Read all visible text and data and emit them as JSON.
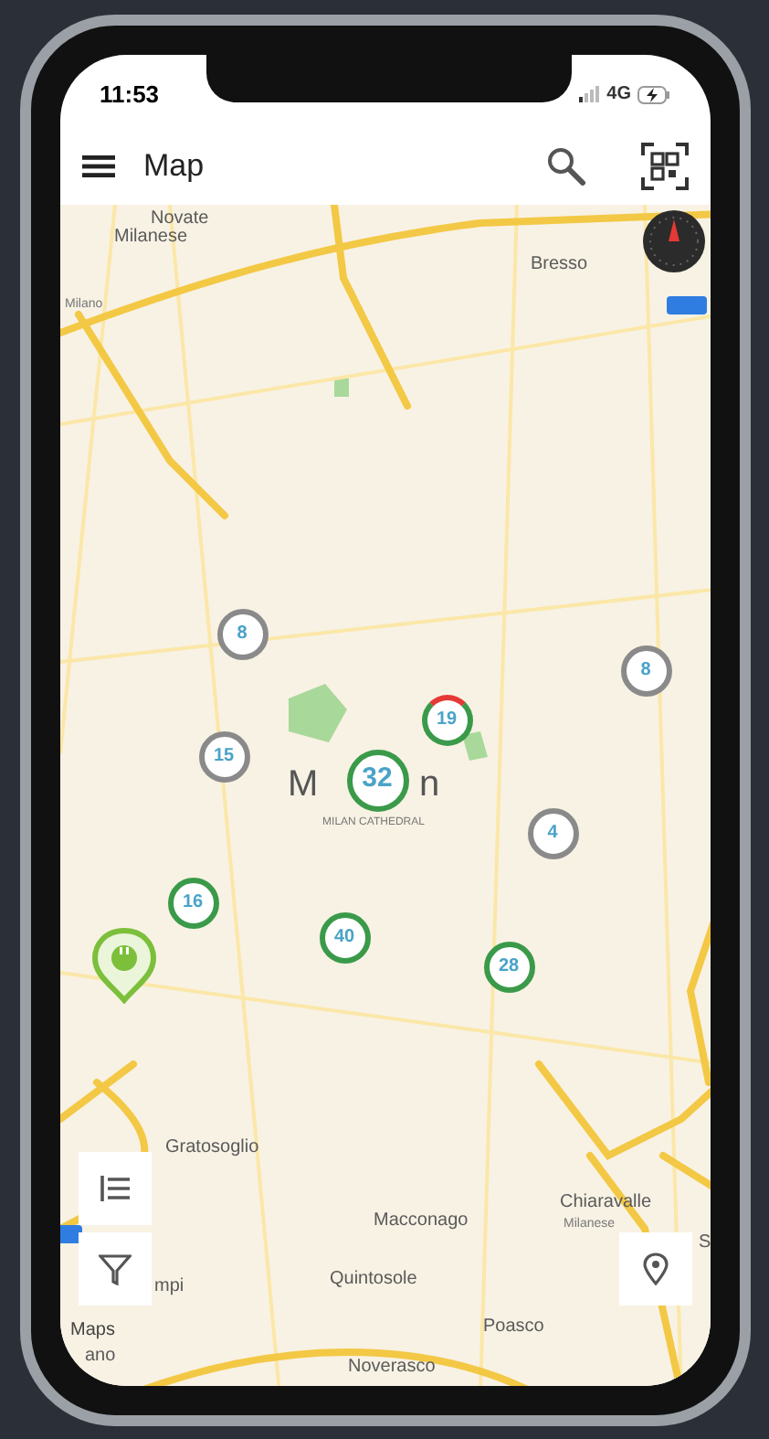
{
  "status_bar": {
    "time": "11:53",
    "network": "4G"
  },
  "app_bar": {
    "title": "Map"
  },
  "map_labels": [
    {
      "text": "Novate",
      "kind": "town"
    },
    {
      "text": "Milanese",
      "kind": "town"
    },
    {
      "text": "Bresso",
      "kind": "town"
    },
    {
      "text": "Milano",
      "kind": "small"
    },
    {
      "text": "M",
      "kind": "city"
    },
    {
      "text": "n",
      "kind": "city"
    },
    {
      "text": "MILAN CATHEDRAL",
      "kind": "poi"
    },
    {
      "text": "Gratosoglio",
      "kind": "town"
    },
    {
      "text": "Macconago",
      "kind": "town"
    },
    {
      "text": "Chiaravalle",
      "kind": "town"
    },
    {
      "text": "Milanese",
      "kind": "small"
    },
    {
      "text": "Quintosole",
      "kind": "town"
    },
    {
      "text": "Poasco",
      "kind": "town"
    },
    {
      "text": "Noverasco",
      "kind": "town"
    },
    {
      "text": "mpi",
      "kind": "town"
    },
    {
      "text": "ano",
      "kind": "town"
    },
    {
      "text": "S",
      "kind": "town"
    }
  ],
  "clusters": [
    {
      "count": "8",
      "color": "#8a8a8a",
      "alert": false
    },
    {
      "count": "8",
      "color": "#8a8a8a",
      "alert": false
    },
    {
      "count": "19",
      "color": "#3a9a4a",
      "alert": true
    },
    {
      "count": "15",
      "color": "#8a8a8a",
      "alert": false
    },
    {
      "count": "32",
      "color": "#3a9a4a",
      "alert": false
    },
    {
      "count": "4",
      "color": "#8a8a8a",
      "alert": false
    },
    {
      "count": "16",
      "color": "#3a9a4a",
      "alert": false
    },
    {
      "count": "40",
      "color": "#3a9a4a",
      "alert": false
    },
    {
      "count": "28",
      "color": "#3a9a4a",
      "alert": false
    }
  ],
  "attribution": "Maps"
}
